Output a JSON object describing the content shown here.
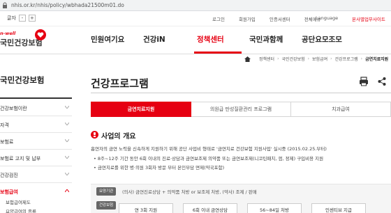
{
  "browser": {
    "url": "nhis.or.kr/nhis/policy/wbhada21500m01.do"
  },
  "utility": {
    "font_label": "글자",
    "font_minus": "-",
    "font_plus": "+",
    "links": [
      "로그인",
      "회원가입",
      "인증서센터",
      "전체메뉴"
    ],
    "language": "Language",
    "branch": "본사별업무사이트"
  },
  "header": {
    "logo_sub": "n-well",
    "logo_main": "국민건강보험",
    "menu": [
      "민원여기요",
      "건강iN",
      "정책센터",
      "국민과함께",
      "공단요모조모"
    ],
    "active_menu": "정책센터"
  },
  "breadcrumb": [
    "정책센터",
    "국민건강보험",
    "보험급여",
    "건강프로그램",
    "금연치료지원"
  ],
  "sidebar": {
    "title": "국민건강보험",
    "items": [
      "건강보험이란",
      "자격",
      "보험료",
      "보험료 고지 및 납부",
      "건강검진",
      "보험급여"
    ],
    "active_item": "보험급여",
    "subitems": [
      "보험급여제도",
      "요양급여의 종류"
    ]
  },
  "main": {
    "title": "건강프로그램",
    "tabs": [
      "금연치료지원",
      "의원급 만성질환관리 프로그램",
      "치과급여"
    ],
    "active_tab": "금연치료지원",
    "section_title": "사업의 개요",
    "paragraph": "흡연자의 금연 노력을 신속하게 지원하기 위해 공단 사업비 형태로 '금연치료 건강보험 지원사업' 실시중 (2015.02.25.부터)",
    "bullets": [
      "• 8주~12주 기간 동안 6회 이내의 진료·상담과 금연보조제 의약품 또는 금연보조제(니코틴패치, 껌, 정제) 구입비용 지원",
      "• 금연치료를 위한 병·의원 3회차 방문 부터 본인부담 면제(약국포함)"
    ],
    "info": {
      "badge1": "요양기관",
      "text1": "(의사) 금연진료상담 + 의약품 처방 or 보조제 처방, (약사) 조제 / 판매",
      "badge2": "건강보험",
      "steps": [
        "연 3회 지원",
        "6회 이내 금연상담",
        "56~84일 처방",
        "인센티브 지급"
      ]
    }
  },
  "colors": {
    "brand": "#e60012",
    "text": "#222222"
  }
}
